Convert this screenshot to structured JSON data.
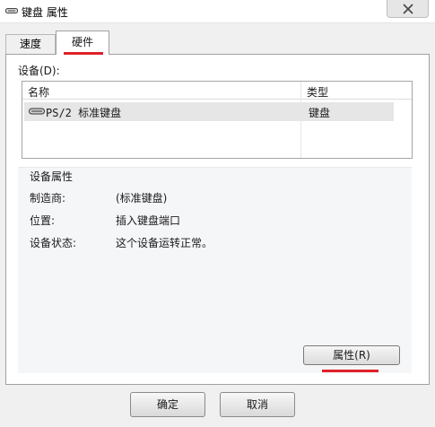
{
  "window": {
    "title": "键盘 属性",
    "close_icon": "close-icon"
  },
  "tabs": [
    {
      "label": "速度",
      "active": false
    },
    {
      "label": "硬件",
      "active": true
    }
  ],
  "devices": {
    "label": "设备(D):",
    "columns": [
      "名称",
      "类型"
    ],
    "rows": [
      {
        "name": "PS/2 标准键盘",
        "type": "键盘",
        "icon": "keyboard-icon",
        "selected": true
      }
    ]
  },
  "properties": {
    "title": "设备属性",
    "items": [
      {
        "label": "制造商:",
        "value": "(标准键盘)"
      },
      {
        "label": "位置:",
        "value": "插入键盘端口"
      },
      {
        "label": "设备状态:",
        "value": "这个设备运转正常。"
      }
    ],
    "button_label": "属性(R)"
  },
  "buttons": {
    "ok": "确定",
    "cancel": "取消"
  },
  "colors": {
    "highlight_underline": "#e0212a",
    "selection": "#e6e6e6"
  }
}
